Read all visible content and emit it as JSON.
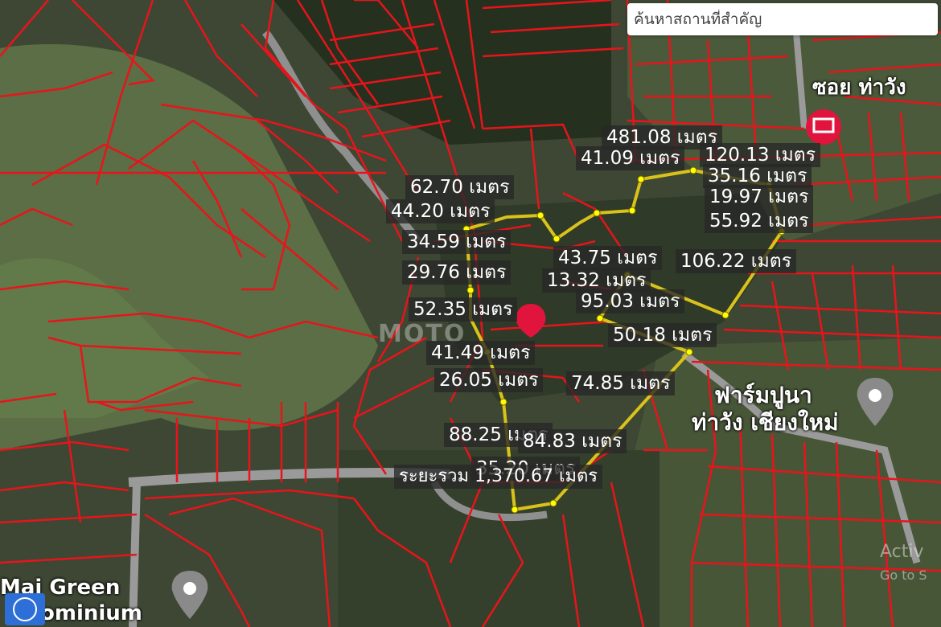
{
  "search": {
    "placeholder": "ค้นหาสถานที่สำคัญ"
  },
  "measurements": [
    "481.08 เมตร",
    "41.09 เมตร",
    "120.13 เมตร",
    "35.16 เมตร",
    "19.97 เมตร",
    "55.92 เมตร",
    "62.70 เมตร",
    "44.20 เมตร",
    "34.59 เมตร",
    "29.76 เมตร",
    "52.35 เมตร",
    "41.49 เมตร",
    "26.05 เมตร",
    "74.85 เมตร",
    "43.75 เมตร",
    "13.32 เมตร",
    "106.22 เมตร",
    "95.03 เมตร",
    "50.18 เมตร",
    "88.25 เมตร",
    "84.83 เมตร",
    "35.20 เมตร"
  ],
  "total": "ระยะรวม 1,370.67 เมตร",
  "places": {
    "farm_name_line1": "ฟาร์มปูนา",
    "farm_name_line2": "ท่าวัง เชียงใหม่",
    "soi_name": "ซอย ท่าวัง",
    "condo_name_line1": "Mai Green",
    "condo_name_line2": "ominium"
  },
  "watermark": {
    "logo": "MOTO",
    "activate_line1": "Activ",
    "activate_line2": "Go to S"
  },
  "colors": {
    "parcel_line": "#e8141b",
    "measure_line": "#d9c21a",
    "vertex": "#ffff00",
    "pin": "#e0143c"
  }
}
